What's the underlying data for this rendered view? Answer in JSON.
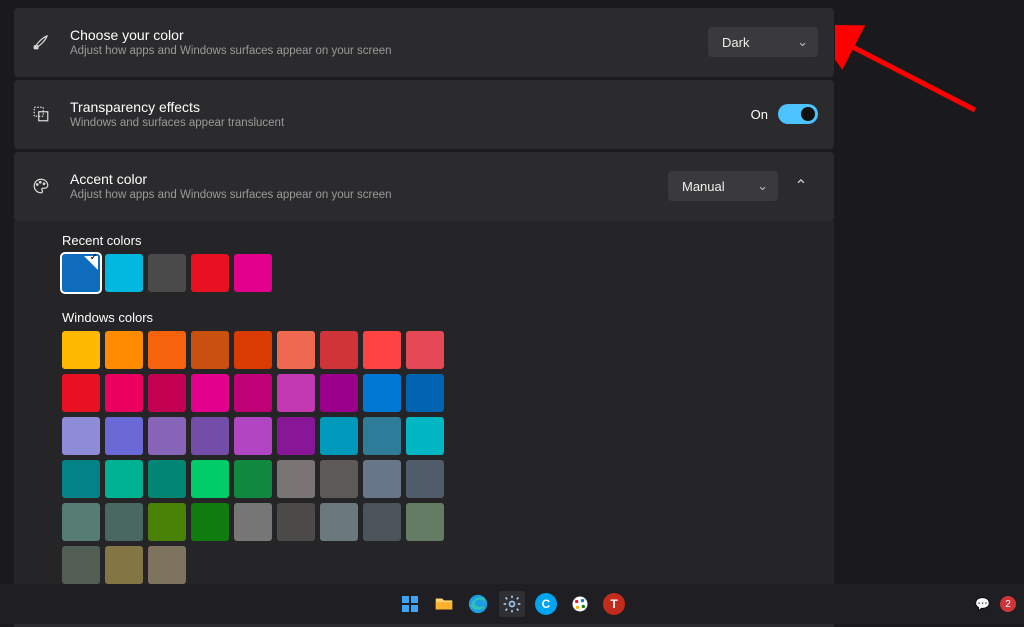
{
  "rows": {
    "color_mode": {
      "title": "Choose your color",
      "sub": "Adjust how apps and Windows surfaces appear on your screen",
      "value": "Dark"
    },
    "transparency": {
      "title": "Transparency effects",
      "sub": "Windows and surfaces appear translucent",
      "state_label": "On",
      "on": true
    },
    "accent": {
      "title": "Accent color",
      "sub": "Adjust how apps and Windows surfaces appear on your screen",
      "value": "Manual"
    }
  },
  "recent": {
    "label": "Recent colors",
    "colors": [
      "#0f6cbd",
      "#00b7e0",
      "#4a4a4a",
      "#e81123",
      "#e3008c"
    ],
    "selected_index": 0
  },
  "windows_colors": {
    "label": "Windows colors",
    "colors": [
      "#ffb900",
      "#ff8c00",
      "#f7630c",
      "#ca5010",
      "#da3b01",
      "#ef6950",
      "#d13438",
      "#ff4343",
      "#e74856",
      "#e81123",
      "#ea005e",
      "#c30052",
      "#e3008c",
      "#bf0077",
      "#c239b3",
      "#9a0089",
      "#0078d4",
      "#0063b1",
      "#8e8cd8",
      "#6b69d6",
      "#8764b8",
      "#744da9",
      "#b146c2",
      "#881798",
      "#0099bc",
      "#2d7d9a",
      "#00b7c3",
      "#038387",
      "#00b294",
      "#018574",
      "#00cc6a",
      "#10893e",
      "#7a7574",
      "#5d5a58",
      "#68768a",
      "#515c6b",
      "#567c73",
      "#486860",
      "#498205",
      "#107c10",
      "#767676",
      "#4c4a48",
      "#69797e",
      "#4a5459",
      "#647c64",
      "#525e54",
      "#847545",
      "#7e735f"
    ]
  },
  "taskbar": {
    "icons": [
      "start",
      "explorer",
      "edge",
      "settings",
      "cortana",
      "paint",
      "app-t"
    ]
  },
  "tray": {
    "badge": "2"
  }
}
